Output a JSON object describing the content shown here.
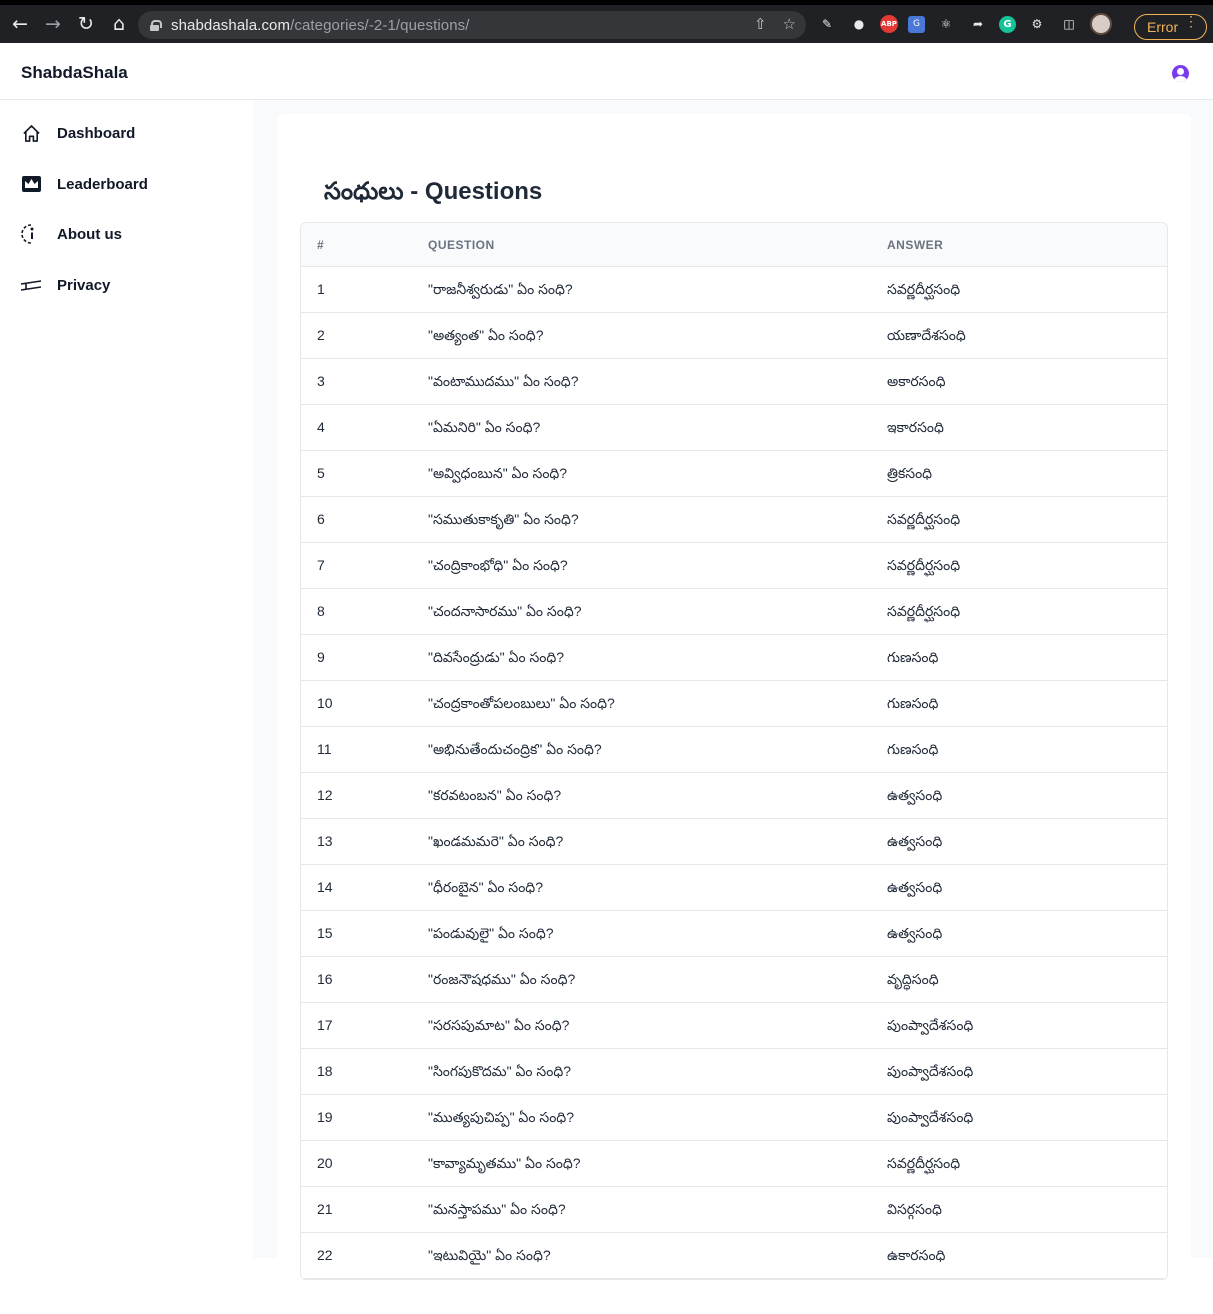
{
  "browser": {
    "url_domain": "shabdashala.com",
    "url_path": "/categories/-2-1/questions/",
    "error_label": "Error",
    "extensions": [
      "pen-icon",
      "cookie-icon",
      "ABP",
      "G",
      "atom-icon",
      "arrow-icon",
      "G",
      "puzzle-icon",
      "sidebar-icon"
    ]
  },
  "app": {
    "logo": "ShabdaShala",
    "accent_color": "#7c3aed"
  },
  "sidebar": {
    "items": [
      {
        "label": "Dashboard",
        "icon": "home-icon"
      },
      {
        "label": "Leaderboard",
        "icon": "crown-icon"
      },
      {
        "label": "About us",
        "icon": "info-icon"
      },
      {
        "label": "Privacy",
        "icon": "privacy-icon"
      }
    ]
  },
  "page": {
    "title": "సంధులు - Questions"
  },
  "table": {
    "headers": [
      "#",
      "QUESTION",
      "ANSWER"
    ],
    "rows": [
      {
        "n": "1",
        "q": "\"రాజనీశ్వరుడు\" ఏం సంధి?",
        "a": "సవర్ణదీర్ఘసంధి"
      },
      {
        "n": "2",
        "q": "\"అత్యంత\" ఏం సంధి?",
        "a": "యణాదేశసంధి"
      },
      {
        "n": "3",
        "q": "\"వంటాముదము\" ఏం సంధి?",
        "a": "అకారసంధి"
      },
      {
        "n": "4",
        "q": "\"ఏమనిరి\" ఏం సంధి?",
        "a": "ఇకారసంధి"
      },
      {
        "n": "5",
        "q": "\"అవ్విధంబున\" ఏం సంధి?",
        "a": "త్రికసంధి"
      },
      {
        "n": "6",
        "q": "\"సముతుకాకృతి\" ఏం సంధి?",
        "a": "సవర్ణదీర్ఘసంధి"
      },
      {
        "n": "7",
        "q": "\"చంద్రికాంభోధి\" ఏం సంధి?",
        "a": "సవర్ణదీర్ఘసంధి"
      },
      {
        "n": "8",
        "q": "\"చందనాసారము\" ఏం సంధి?",
        "a": "సవర్ణదీర్ఘసంధి"
      },
      {
        "n": "9",
        "q": "\"దివసేంద్రుడు\" ఏం సంధి?",
        "a": "గుణసంధి"
      },
      {
        "n": "10",
        "q": "\"చంద్రకాంతోపలంబులు\" ఏం సంధి?",
        "a": "గుణసంధి"
      },
      {
        "n": "11",
        "q": "\"అభినుతేందుచంద్రిక\" ఏం సంధి?",
        "a": "గుణసంధి"
      },
      {
        "n": "12",
        "q": "\"కరవటంబన\" ఏం సంధి?",
        "a": "ఉత్వసంధి"
      },
      {
        "n": "13",
        "q": "\"ఖండమమరె\" ఏం సంధి?",
        "a": "ఉత్వసంధి"
      },
      {
        "n": "14",
        "q": "\"ధీరంబైన\" ఏం సంధి?",
        "a": "ఉత్వసంధి"
      },
      {
        "n": "15",
        "q": "\"పండువులై\" ఏం సంధి?",
        "a": "ఉత్వసంధి"
      },
      {
        "n": "16",
        "q": "\"రంజనౌషధము\" ఏం సంధి?",
        "a": "వృద్ధిసంధి"
      },
      {
        "n": "17",
        "q": "\"సరసపుమాట\" ఏం సంధి?",
        "a": "పుంప్వాదేశసంధి"
      },
      {
        "n": "18",
        "q": "\"సింగపుకొదమ\" ఏం సంధి?",
        "a": "పుంప్వాదేశసంధి"
      },
      {
        "n": "19",
        "q": "\"ముత్యపుచిప్ప\" ఏం సంధి?",
        "a": "పుంప్వాదేశసంధి"
      },
      {
        "n": "20",
        "q": "\"కావ్యామృతము\" ఏం సంధి?",
        "a": "సవర్ణదీర్ఘసంధి"
      },
      {
        "n": "21",
        "q": "\"మనస్తాపము\" ఏం సంధి?",
        "a": "విసర్గసంధి"
      },
      {
        "n": "22",
        "q": "\"ఇటువియై\" ఏం సంధి?",
        "a": "ఉకారసంధి"
      }
    ]
  }
}
